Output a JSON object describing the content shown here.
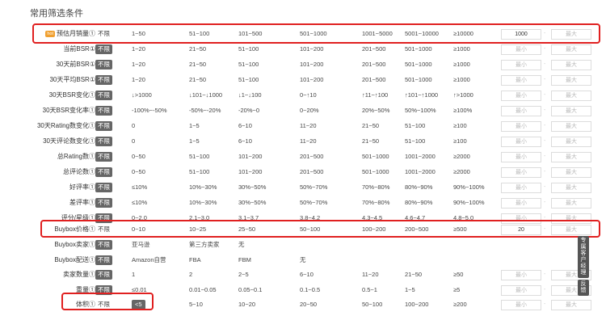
{
  "section_title": "常用筛选条件",
  "hot_badge": "hot",
  "rows": [
    {
      "label": "预估月销量①",
      "nolimit": "不限",
      "active": false,
      "hot": true,
      "options": [
        "1~50",
        "51~100",
        "101~500",
        "501~1000",
        "1001~5000",
        "5001~10000",
        "≥10000"
      ],
      "min": "1000",
      "max": "最大"
    },
    {
      "label": "当前BSR①",
      "nolimit": "不限",
      "active": true,
      "options": [
        "1~20",
        "21~50",
        "51~100",
        "101~200",
        "201~500",
        "501~1000",
        "≥1000"
      ],
      "min": "最小",
      "max": "最大"
    },
    {
      "label": "30天前BSR①",
      "nolimit": "不限",
      "active": true,
      "options": [
        "1~20",
        "21~50",
        "51~100",
        "101~200",
        "201~500",
        "501~1000",
        "≥1000"
      ],
      "min": "最小",
      "max": "最大"
    },
    {
      "label": "30天平均BSR①",
      "nolimit": "不限",
      "active": true,
      "options": [
        "1~20",
        "21~50",
        "51~100",
        "101~200",
        "201~500",
        "501~1000",
        "≥1000"
      ],
      "min": "最小",
      "max": "最大"
    },
    {
      "label": "30天BSR变化①",
      "nolimit": "不限",
      "active": true,
      "options": [
        "↓>1000",
        "↓101~↓1000",
        "↓1~↓100",
        "0~↑10",
        "↑11~↑100",
        "↑101~↑1000",
        "↑>1000"
      ],
      "min": "最小",
      "max": "最大"
    },
    {
      "label": "30天BSR变化率①",
      "nolimit": "不限",
      "active": true,
      "options": [
        "-100%~-50%",
        "-50%~-20%",
        "-20%~0",
        "0~20%",
        "20%~50%",
        "50%~100%",
        "≥100%"
      ],
      "min": "最小",
      "max": "最大"
    },
    {
      "label": "30天Rating数变化①",
      "nolimit": "不限",
      "active": true,
      "options": [
        "0",
        "1~5",
        "6~10",
        "11~20",
        "21~50",
        "51~100",
        "≥100"
      ],
      "min": "最小",
      "max": "最大"
    },
    {
      "label": "30天评论数变化①",
      "nolimit": "不限",
      "active": true,
      "options": [
        "0",
        "1~5",
        "6~10",
        "11~20",
        "21~50",
        "51~100",
        "≥100"
      ],
      "min": "最小",
      "max": "最大"
    },
    {
      "label": "总Rating数①",
      "nolimit": "不限",
      "active": true,
      "options": [
        "0~50",
        "51~100",
        "101~200",
        "201~500",
        "501~1000",
        "1001~2000",
        "≥2000"
      ],
      "min": "最小",
      "max": "最大"
    },
    {
      "label": "总评论数①",
      "nolimit": "不限",
      "active": true,
      "options": [
        "0~50",
        "51~100",
        "101~200",
        "201~500",
        "501~1000",
        "1001~2000",
        "≥2000"
      ],
      "min": "最小",
      "max": "最大"
    },
    {
      "label": "好评率①",
      "nolimit": "不限",
      "active": true,
      "options": [
        "≤10%",
        "10%~30%",
        "30%~50%",
        "50%~70%",
        "70%~80%",
        "80%~90%",
        "90%~100%"
      ],
      "min": "最小",
      "max": "最大"
    },
    {
      "label": "差评率①",
      "nolimit": "不限",
      "active": true,
      "options": [
        "≤10%",
        "10%~30%",
        "30%~50%",
        "50%~70%",
        "70%~80%",
        "80%~90%",
        "90%~100%"
      ],
      "min": "最小",
      "max": "最大"
    },
    {
      "label": "评分/星级①",
      "nolimit": "不限",
      "active": true,
      "options": [
        "0~2.0",
        "2.1~3.0",
        "3.1~3.7",
        "3.8~4.2",
        "4.3~4.5",
        "4.6~4.7",
        "4.8~5.0"
      ],
      "min": "最小",
      "max": "最大"
    },
    {
      "label": "Buybox价格①",
      "nolimit": "不限",
      "active": false,
      "options": [
        "0~10",
        "10~25",
        "25~50",
        "50~100",
        "100~200",
        "200~500",
        "≥500"
      ],
      "min": "20",
      "max": "最大"
    },
    {
      "label": "Buybox卖家①",
      "nolimit": "不限",
      "active": true,
      "options": [
        "亚马逊",
        "第三方卖家",
        "无"
      ],
      "min": "",
      "max": ""
    },
    {
      "label": "Buybox配送①",
      "nolimit": "不限",
      "active": true,
      "options": [
        "Amazon自营",
        "FBA",
        "FBM",
        "无"
      ],
      "min": "",
      "max": ""
    },
    {
      "label": "卖家数量①",
      "nolimit": "不限",
      "active": true,
      "options": [
        "1",
        "2",
        "2~5",
        "6~10",
        "11~20",
        "21~50",
        "≥50"
      ],
      "min": "最小",
      "max": "最大"
    },
    {
      "label": "重量①",
      "nolimit": "不限",
      "active": true,
      "options": [
        "≤0.01",
        "0.01~0.05",
        "0.05~0.1",
        "0.1~0.5",
        "0.5~1",
        "1~5",
        "≥5"
      ],
      "min": "最小",
      "max": "最大"
    },
    {
      "label": "体积①",
      "nolimit": "不限",
      "active": false,
      "selected_option": 0,
      "options": [
        "<5",
        "5~10",
        "10~20",
        "20~50",
        "50~100",
        "100~200",
        "≥200"
      ],
      "min": "最小",
      "max": "最大"
    }
  ],
  "side_buttons": [
    "专属客户经理",
    "反馈"
  ]
}
